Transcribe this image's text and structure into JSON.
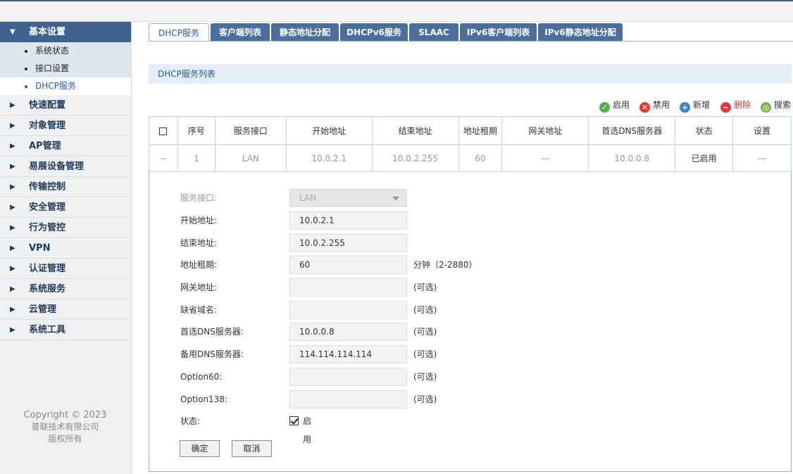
{
  "sidebar": {
    "groups": [
      {
        "label": "基本设置",
        "active": true,
        "items": [
          {
            "label": "系统状态"
          },
          {
            "label": "接口设置"
          },
          {
            "label": "DHCP服务",
            "active": true
          }
        ]
      },
      {
        "label": "快速配置"
      },
      {
        "label": "对象管理"
      },
      {
        "label": "AP管理"
      },
      {
        "label": "易展设备管理"
      },
      {
        "label": "传输控制"
      },
      {
        "label": "安全管理"
      },
      {
        "label": "行为管控"
      },
      {
        "label": "VPN"
      },
      {
        "label": "认证管理"
      },
      {
        "label": "系统服务"
      },
      {
        "label": "云管理"
      },
      {
        "label": "系统工具"
      }
    ],
    "copyright": [
      "Copyright © 2023",
      "普联技术有限公司",
      "版权所有"
    ]
  },
  "tabs": [
    "DHCP服务",
    "客户端列表",
    "静态地址分配",
    "DHCPv6服务",
    "SLAAC",
    "IPv6客户端列表",
    "IPv6静态地址分配"
  ],
  "section_title": "DHCP服务列表",
  "toolbar": {
    "enable": "启用",
    "disable": "禁用",
    "add": "新增",
    "delete": "删除",
    "search": "搜索"
  },
  "table": {
    "headers": [
      "序号",
      "服务接口",
      "开始地址",
      "结束地址",
      "地址租期",
      "网关地址",
      "首选DNS服务器",
      "状态",
      "设置"
    ],
    "row": {
      "check": "--",
      "index": "1",
      "interface": "LAN",
      "start": "10.0.2.1",
      "end": "10.0.2.255",
      "lease": "60",
      "gateway": "---",
      "dns": "10.0.0.8",
      "status": "已启用",
      "settings": "---"
    }
  },
  "form": {
    "interface_label": "服务接口:",
    "interface_value": "LAN",
    "start_label": "开始地址:",
    "start_value": "10.0.2.1",
    "end_label": "结束地址:",
    "end_value": "10.0.2.255",
    "lease_label": "地址租期:",
    "lease_value": "60",
    "lease_hint": "分钟（2-2880）",
    "gateway_label": "网关地址:",
    "gateway_value": "",
    "domain_label": "缺省域名:",
    "domain_value": "",
    "dns1_label": "首选DNS服务器:",
    "dns1_value": "10.0.0.8",
    "dns2_label": "备用DNS服务器:",
    "dns2_value": "114.114.114.114",
    "opt60_label": "Option60:",
    "opt60_value": "",
    "opt138_label": "Option138:",
    "opt138_value": "",
    "optional_hint": "(可选)",
    "status_label": "状态:",
    "status_check_label": "启用",
    "ok_button": "确定",
    "cancel_button": "取消"
  }
}
